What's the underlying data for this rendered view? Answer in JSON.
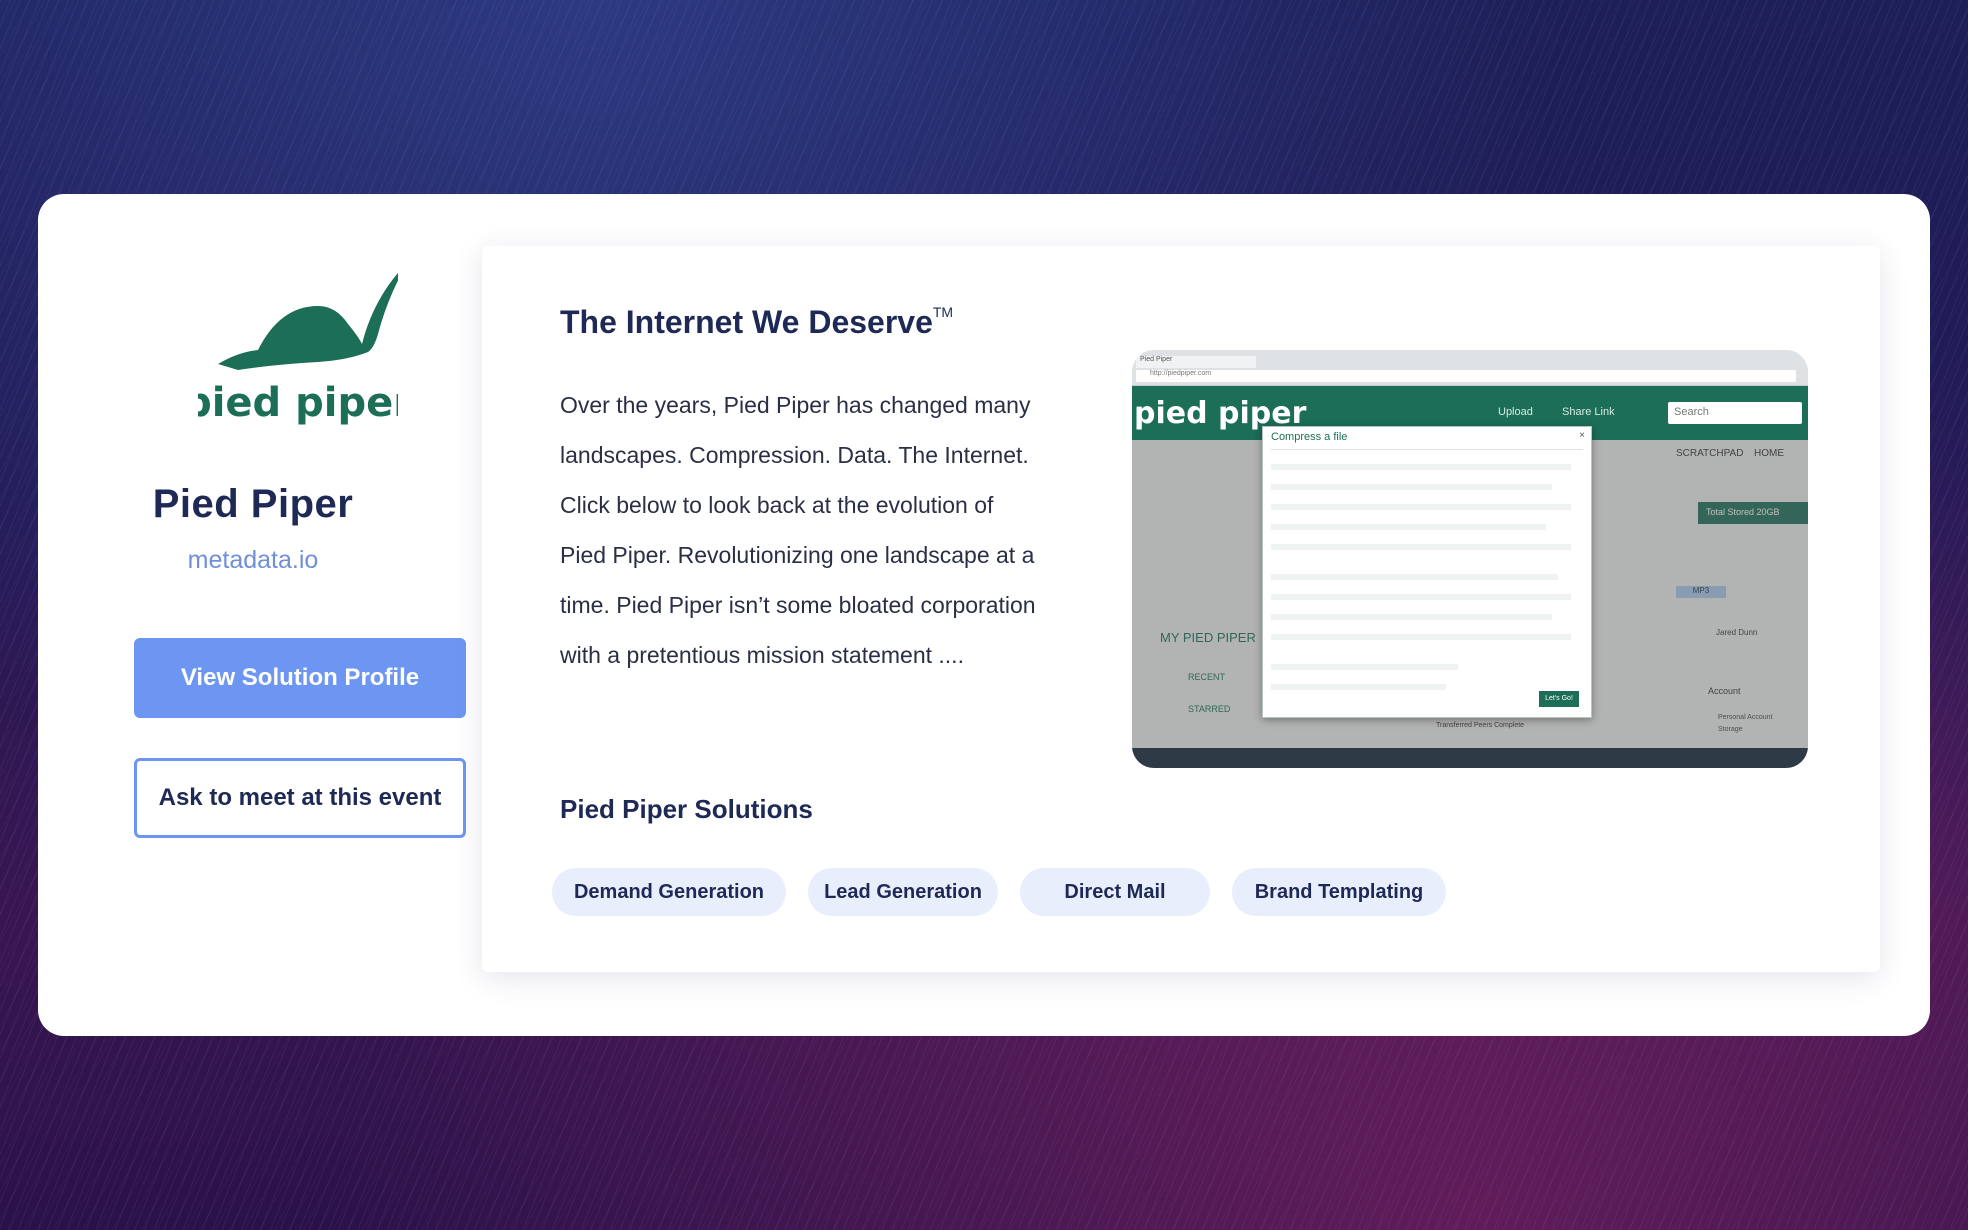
{
  "company": {
    "name": "Pied Piper",
    "domain": "metadata.io",
    "logo_text": "pied piper",
    "brand_color": "#1c6e57"
  },
  "actions": {
    "view_profile_label": "View Solution Profile",
    "ask_meet_label": "Ask to meet at this event"
  },
  "about": {
    "headline": "The Internet We Deserve",
    "trademark": "TM",
    "description": "Over the years, Pied Piper has changed many landscapes. Compression. Data. The Internet. Click below to look back at the evolution of Pied Piper. Revolutionizing one landscape at a time. Pied Piper isn’t some bloated corporation with a pretentious mission statement ...."
  },
  "solutions": {
    "title": "Pied Piper Solutions",
    "tags": [
      "Demand Generation",
      "Lead Generation",
      "Direct Mail",
      "Brand Templating"
    ]
  },
  "media": {
    "screenshot": {
      "tab": "Pied Piper",
      "url": "http://piedpiper.com",
      "brand": "pied piper",
      "upload": "Upload",
      "share_link": "Share Link",
      "search_placeholder": "Search",
      "dialog_title": "Compress a file",
      "scratchpad": "SCRATCHPAD",
      "home": "HOME",
      "total_stored": "Total Stored   20GB",
      "sidebar_title": "MY PIED PIPER",
      "recent": "RECENT",
      "starred": "STARRED",
      "mp3": "MP3",
      "user": "Jared Dunn",
      "account": "Account",
      "personal_account": "Personal Account",
      "storage": "Storage",
      "transfer": "Transferred     Peers     Complete",
      "go_button": "Let's Go!"
    }
  },
  "colors": {
    "primary_button": "#6d96f2",
    "heading": "#1e2a55",
    "tag_bg": "#e8eefc",
    "domain_link": "#6f8fd9"
  }
}
